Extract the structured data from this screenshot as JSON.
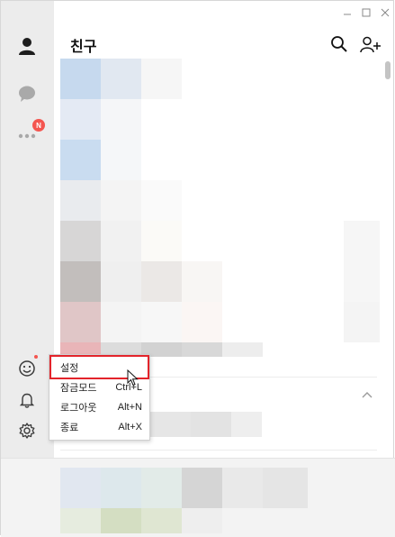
{
  "window": {
    "controls": {
      "minimize": "minimize-icon",
      "maximize": "maximize-icon",
      "close": "close-icon"
    }
  },
  "sidebar": {
    "items": [
      {
        "name": "friends",
        "icon": "person-icon"
      },
      {
        "name": "chats",
        "icon": "chat-bubble-icon"
      },
      {
        "name": "more",
        "icon": "more-dots-icon",
        "badge": "N"
      }
    ],
    "bottom": [
      {
        "name": "emoticon",
        "icon": "smiley-icon"
      },
      {
        "name": "notifications",
        "icon": "bell-icon"
      },
      {
        "name": "settings",
        "icon": "gear-icon"
      }
    ]
  },
  "header": {
    "title": "친구",
    "search_icon": "search-icon",
    "add_friend_icon": "add-friend-icon"
  },
  "context_menu": {
    "items": [
      {
        "label": "설정",
        "shortcut": ""
      },
      {
        "label": "잠금모드",
        "shortcut": "Ctrl+L"
      },
      {
        "label": "로그아웃",
        "shortcut": "Alt+N"
      },
      {
        "label": "종료",
        "shortcut": "Alt+X"
      }
    ],
    "highlighted": "설정"
  },
  "colors": {
    "accent_red": "#e3242b",
    "badge": "#f4554f",
    "sidebar_bg": "#ececec"
  }
}
